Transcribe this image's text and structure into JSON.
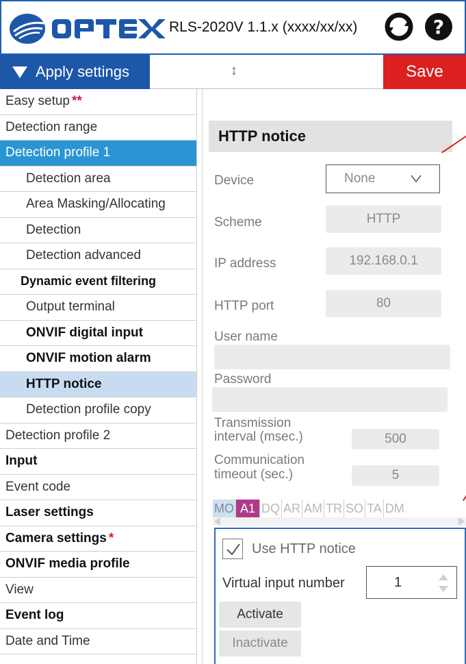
{
  "header": {
    "brand": "OPTEX",
    "version": "RLS-2020V 1.1.x (xxxx/xx/xx)",
    "brand_color": "#1d57a8"
  },
  "toolbar": {
    "apply_label": "Apply settings",
    "resize_glyph": "↕",
    "save_label": "Save",
    "save_color": "#dc1f1f"
  },
  "sidebar": {
    "items": [
      {
        "label": "Easy setup",
        "mark": "**"
      },
      {
        "label": "Detection range"
      },
      {
        "label": "Detection profile 1"
      },
      {
        "label": "Detection area"
      },
      {
        "label": "Area Masking/Allocating"
      },
      {
        "label": "Detection"
      },
      {
        "label": "Detection advanced"
      },
      {
        "label": "Dynamic event filtering"
      },
      {
        "label": "Output terminal"
      },
      {
        "label": "ONVIF digital input"
      },
      {
        "label": "ONVIF motion alarm"
      },
      {
        "label": "HTTP notice"
      },
      {
        "label": "Detection profile copy"
      },
      {
        "label": "Detection profile 2"
      },
      {
        "label": "Input"
      },
      {
        "label": "Event code"
      },
      {
        "label": "Laser settings"
      },
      {
        "label": "Camera settings",
        "mark": "*"
      },
      {
        "label": "ONVIF media profile"
      },
      {
        "label": "View"
      },
      {
        "label": "Event log"
      },
      {
        "label": "Date and Time"
      }
    ]
  },
  "main": {
    "title": "HTTP notice",
    "device": {
      "label": "Device",
      "value": "None"
    },
    "scheme": {
      "label": "Scheme",
      "value": "HTTP"
    },
    "ip": {
      "label": "IP address",
      "value": "192.168.0.1"
    },
    "port": {
      "label": "HTTP port",
      "value": "80"
    },
    "user": {
      "label": "User name",
      "value": ""
    },
    "password": {
      "label": "Password",
      "value": ""
    },
    "interval": {
      "label_line1": "Transmission",
      "label_line2": "interval (msec.)",
      "value": "500"
    },
    "timeout": {
      "label_line1": "Communication",
      "label_line2": "timeout (sec.)",
      "value": "5"
    },
    "tabs": [
      "MO",
      "A1",
      "DQ",
      "AR",
      "AM",
      "TR",
      "SO",
      "TA",
      "DM"
    ],
    "notice": {
      "use_label": "Use HTTP notice",
      "use_checked": true,
      "vin_label": "Virtual input number",
      "vin_value": "1",
      "activate_label": "Activate",
      "inactivate_label": "Inactivate"
    }
  }
}
